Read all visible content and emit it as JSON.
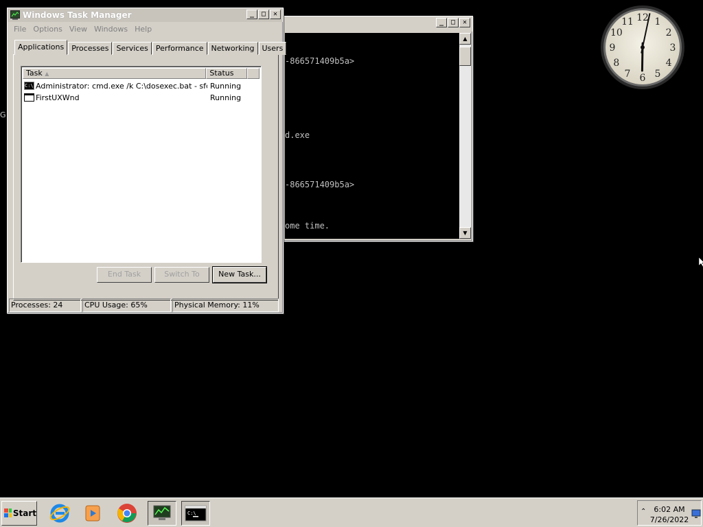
{
  "cmd_window": {
    "lines": [
      "-866571409b5a>",
      "d.exe",
      "-866571409b5a>",
      "ome time."
    ]
  },
  "task_manager": {
    "title": "Windows Task Manager",
    "menu": [
      "File",
      "Options",
      "View",
      "Windows",
      "Help"
    ],
    "tabs": [
      "Applications",
      "Processes",
      "Services",
      "Performance",
      "Networking",
      "Users"
    ],
    "active_tab": "Applications",
    "columns": [
      "Task",
      "Status"
    ],
    "rows": [
      {
        "task": "Administrator: cmd.exe /k C:\\dosexec.bat - sfc ...",
        "status": "Running",
        "icon": "cmd-icon"
      },
      {
        "task": "FirstUXWnd",
        "status": "Running",
        "icon": "window-icon"
      }
    ],
    "buttons": {
      "end_task": "End Task",
      "switch_to": "Switch To",
      "new_task": "New Task..."
    },
    "statusbar": {
      "processes": "Processes: 24",
      "cpu": "CPU Usage: 65%",
      "memory": "Physical Memory: 11%"
    }
  },
  "clock_gadget": {
    "numerals": [
      "12",
      "1",
      "2",
      "3",
      "4",
      "5",
      "6",
      "7",
      "8",
      "9",
      "10",
      "11"
    ],
    "hour": 6,
    "minute": 2
  },
  "taskbar": {
    "start_label": "Start",
    "icons": [
      "internet-explorer-icon",
      "media-player-icon",
      "chrome-icon",
      "task-manager-icon",
      "cmd-icon"
    ],
    "time": "6:02 AM",
    "date": "7/26/2022"
  },
  "desktop": {
    "edge_letter": "G"
  }
}
